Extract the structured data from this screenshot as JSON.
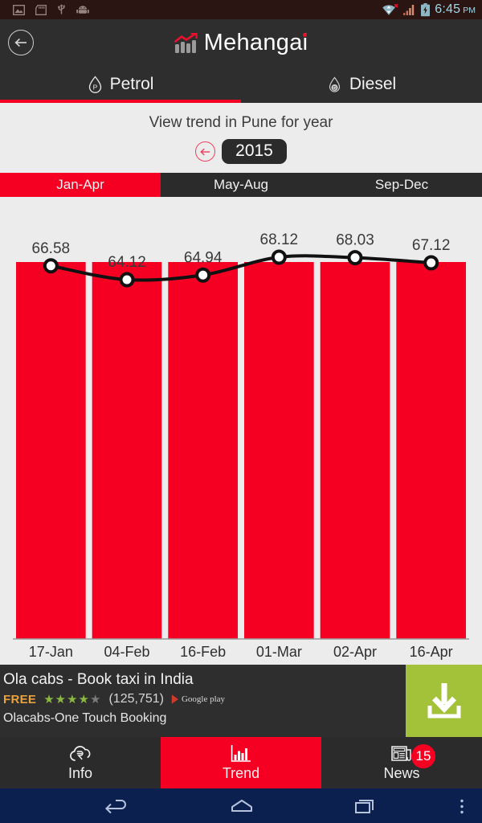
{
  "status_bar": {
    "time": "6:45",
    "meridiem": "PM",
    "left_icons": [
      "image-icon",
      "sd-card-icon",
      "usb-icon",
      "android-robot-icon"
    ],
    "right_icons": [
      "wifi-icon",
      "signal-icon",
      "battery-charging-icon"
    ],
    "background": "#2b1512",
    "text_color": "#9fd8e6"
  },
  "app_bar": {
    "back_label": "back",
    "title": "Mehangai",
    "accent": "#e8112d"
  },
  "fuel_tabs": {
    "items": [
      {
        "label": "Petrol",
        "icon": "petrol-droplet-icon",
        "letter": "P",
        "active": true
      },
      {
        "label": "Diesel",
        "icon": "diesel-droplet-icon",
        "letter": "D",
        "active": false
      }
    ],
    "active_color": "#f50023"
  },
  "sub_header": {
    "title": "View trend in Pune for year",
    "prev_year_label": "previous year",
    "year": "2015"
  },
  "quarters": {
    "items": [
      {
        "label": "Jan-Apr",
        "active": true
      },
      {
        "label": "May-Aug",
        "active": false
      },
      {
        "label": "Sep-Dec",
        "active": false
      }
    ]
  },
  "chart_data": {
    "type": "bar",
    "title": "",
    "xlabel": "",
    "ylabel": "",
    "categories": [
      "17-Jan",
      "04-Feb",
      "16-Feb",
      "01-Mar",
      "02-Apr",
      "16-Apr"
    ],
    "values": [
      66.58,
      64.12,
      64.94,
      68.12,
      68.03,
      67.12
    ],
    "data_labels": [
      "66.58",
      "64.12",
      "64.94",
      "68.12",
      "68.03",
      "67.12"
    ],
    "series": [
      {
        "name": "Petrol price",
        "type": "bar",
        "values": [
          66.58,
          64.12,
          64.94,
          68.12,
          68.03,
          67.12
        ]
      },
      {
        "name": "Trend line",
        "type": "line",
        "values": [
          66.58,
          64.12,
          64.94,
          68.12,
          68.03,
          67.12
        ]
      }
    ],
    "bar_color": "#f50023",
    "line_color": "#111111",
    "marker_fill": "#ffffff",
    "background": "#ececec",
    "grid": false,
    "legend": "none",
    "ylim": [
      62,
      70
    ]
  },
  "ad": {
    "title": "Ola cabs - Book taxi in India",
    "price": "FREE",
    "rating": 4,
    "rating_max": 5,
    "review_count": "(125,751)",
    "store": "Google play",
    "subtitle": "Olacabs-One Touch Booking",
    "cta_icon": "download-icon",
    "cta_color": "#a3c23a"
  },
  "bottom_nav": {
    "items": [
      {
        "label": "Info",
        "icon": "cloud-rupee-icon",
        "active": false,
        "badge": ""
      },
      {
        "label": "Trend",
        "icon": "bar-chart-icon",
        "active": true,
        "badge": ""
      },
      {
        "label": "News",
        "icon": "newspaper-icon",
        "active": false,
        "badge": "15"
      }
    ],
    "active_color": "#f50023"
  },
  "system_nav": {
    "back_label": "Back",
    "home_label": "Home",
    "recents_label": "Recent apps",
    "menu_label": "Menu",
    "background": "#0c2050"
  }
}
